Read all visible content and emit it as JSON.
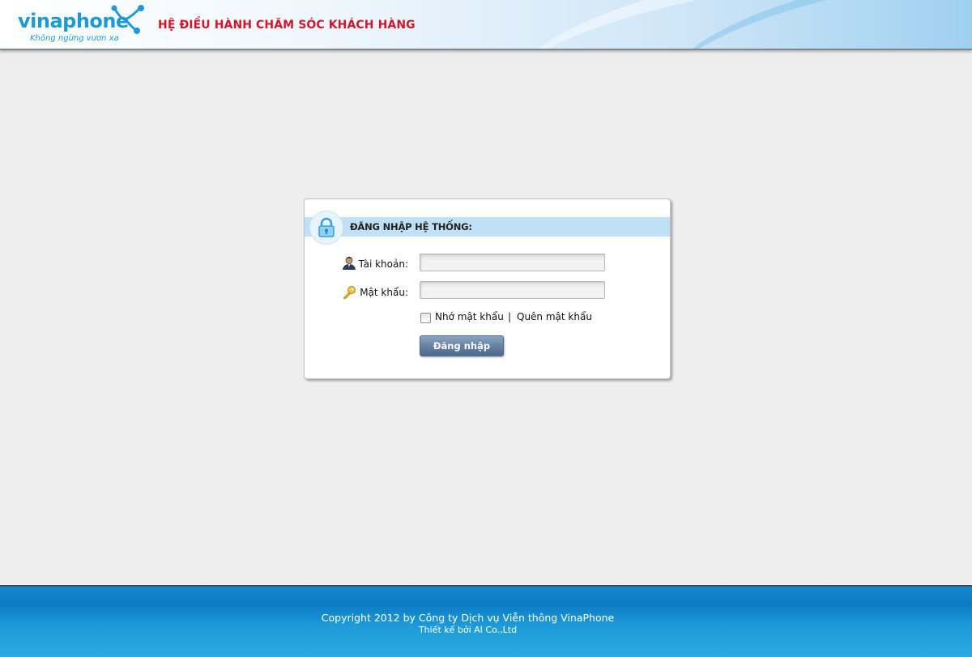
{
  "header": {
    "logo_text": "vinaphone",
    "logo_slogan": "Không ngừng vươn xa",
    "title": "HỆ ĐIỀU HÀNH CHĂM SÓC KHÁCH HÀNG"
  },
  "login": {
    "title": "ĐĂNG NHẬP HỆ THỐNG:",
    "username_label": "Tài khoản:",
    "username_value": "",
    "password_label": "Mật khẩu:",
    "password_value": "",
    "remember_label": "Nhớ mật khẩu",
    "remember_checked": false,
    "separator": "|",
    "forgot_label": "Quên mật khẩu",
    "submit_label": "Đăng nhập"
  },
  "footer": {
    "copyright": "Copyright 2012 by Công ty Dịch vụ Viễn thông VinaPhone",
    "designer": "Thiết kế bởi AI Co.,Ltd"
  },
  "colors": {
    "brand_blue": "#1b9ad7",
    "header_title_red": "#d2172b",
    "page_bg": "#eeeeee",
    "button_blue": "#5f7ca0"
  },
  "icons": [
    "lock-icon",
    "user-icon",
    "key-icon"
  ]
}
